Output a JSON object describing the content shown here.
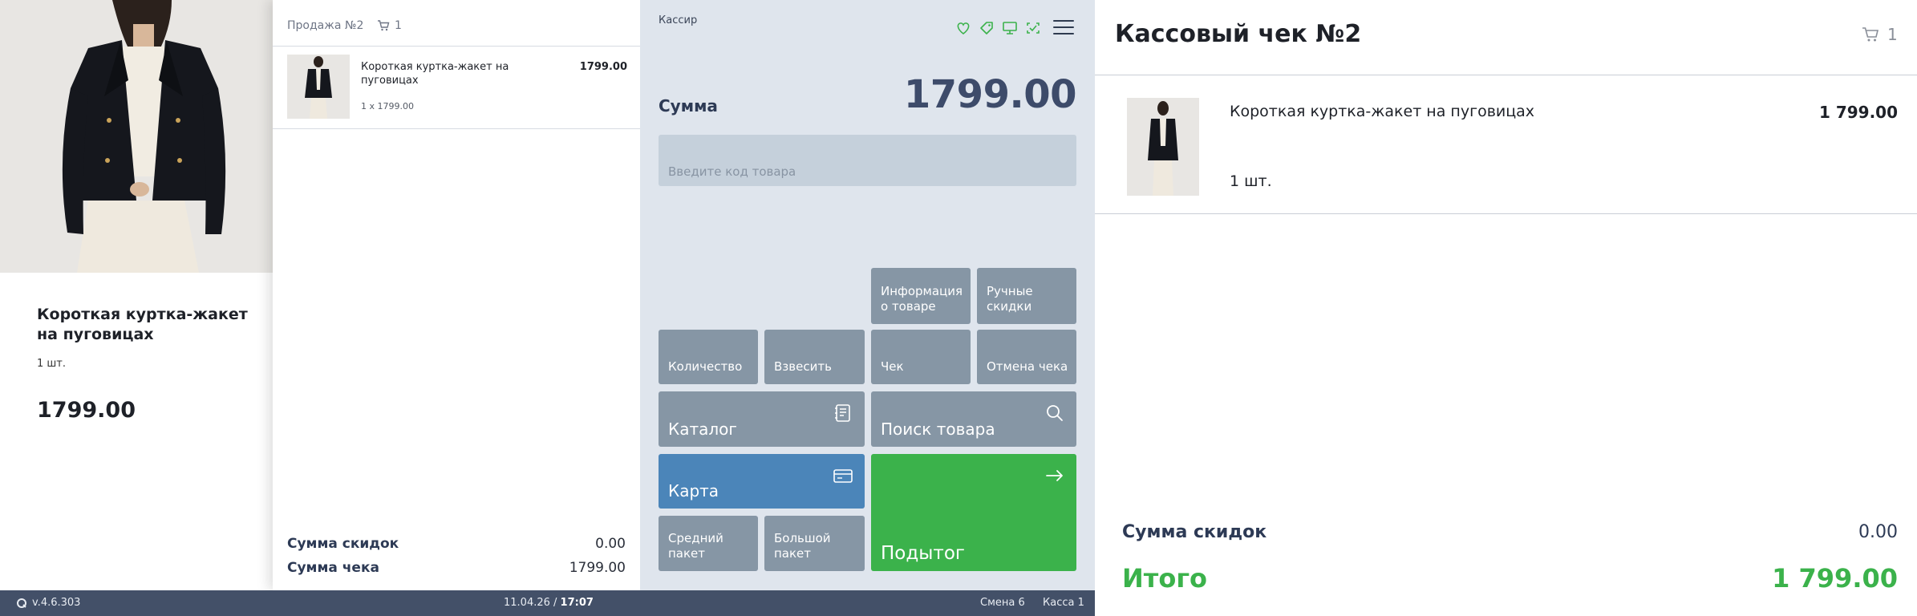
{
  "preview": {
    "product_name": "Короткая куртка-жакет на пуговицах",
    "quantity": "1 шт.",
    "price": "1799.00"
  },
  "sale": {
    "title": "Продажа №2",
    "cart_count": "1",
    "items": [
      {
        "name": "Короткая куртка-жакет на пуговицах",
        "price": "1799.00",
        "calc": "1 x 1799.00"
      }
    ],
    "discount_label": "Сумма скидок",
    "discount_value": "0.00",
    "total_label": "Сумма чека",
    "total_value": "1799.00"
  },
  "cashier": {
    "title": "Кассир",
    "sum_label": "Сумма",
    "sum_value": "1799.00",
    "code_placeholder": "Введите код товара",
    "icons": [
      "heart-icon",
      "tag-icon",
      "monitor-icon",
      "scan-icon",
      "menu-icon"
    ],
    "buttons": {
      "product_info": "Информация о товаре",
      "manual_discounts": "Ручные скидки",
      "quantity": "Количество",
      "weigh": "Взвесить",
      "receipt": "Чек",
      "cancel_receipt": "Отмена чека",
      "catalog": "Каталог",
      "search_product": "Поиск товара",
      "card": "Карта",
      "medium_bag": "Средний пакет",
      "large_bag": "Большой пакет",
      "subtotal": "Подытог"
    },
    "colors": {
      "gray_button": "#8696a5",
      "card_button": "#4b85b9",
      "subtotal_button": "#3bb24b"
    }
  },
  "receipt": {
    "title": "Кассовый чек №2",
    "cart_count": "1",
    "items": [
      {
        "name": "Короткая куртка-жакет на пуговицах",
        "quantity": "1 шт.",
        "price": "1 799.00"
      }
    ],
    "discount_label": "Сумма скидок",
    "discount_value": "0.00",
    "total_label": "Итого",
    "total_value": "1 799.00"
  },
  "status": {
    "version": "v.4.6.303",
    "date": "11.04.26 /",
    "time": "17:07",
    "shift": "Смена 6",
    "register": "Касса 1"
  }
}
